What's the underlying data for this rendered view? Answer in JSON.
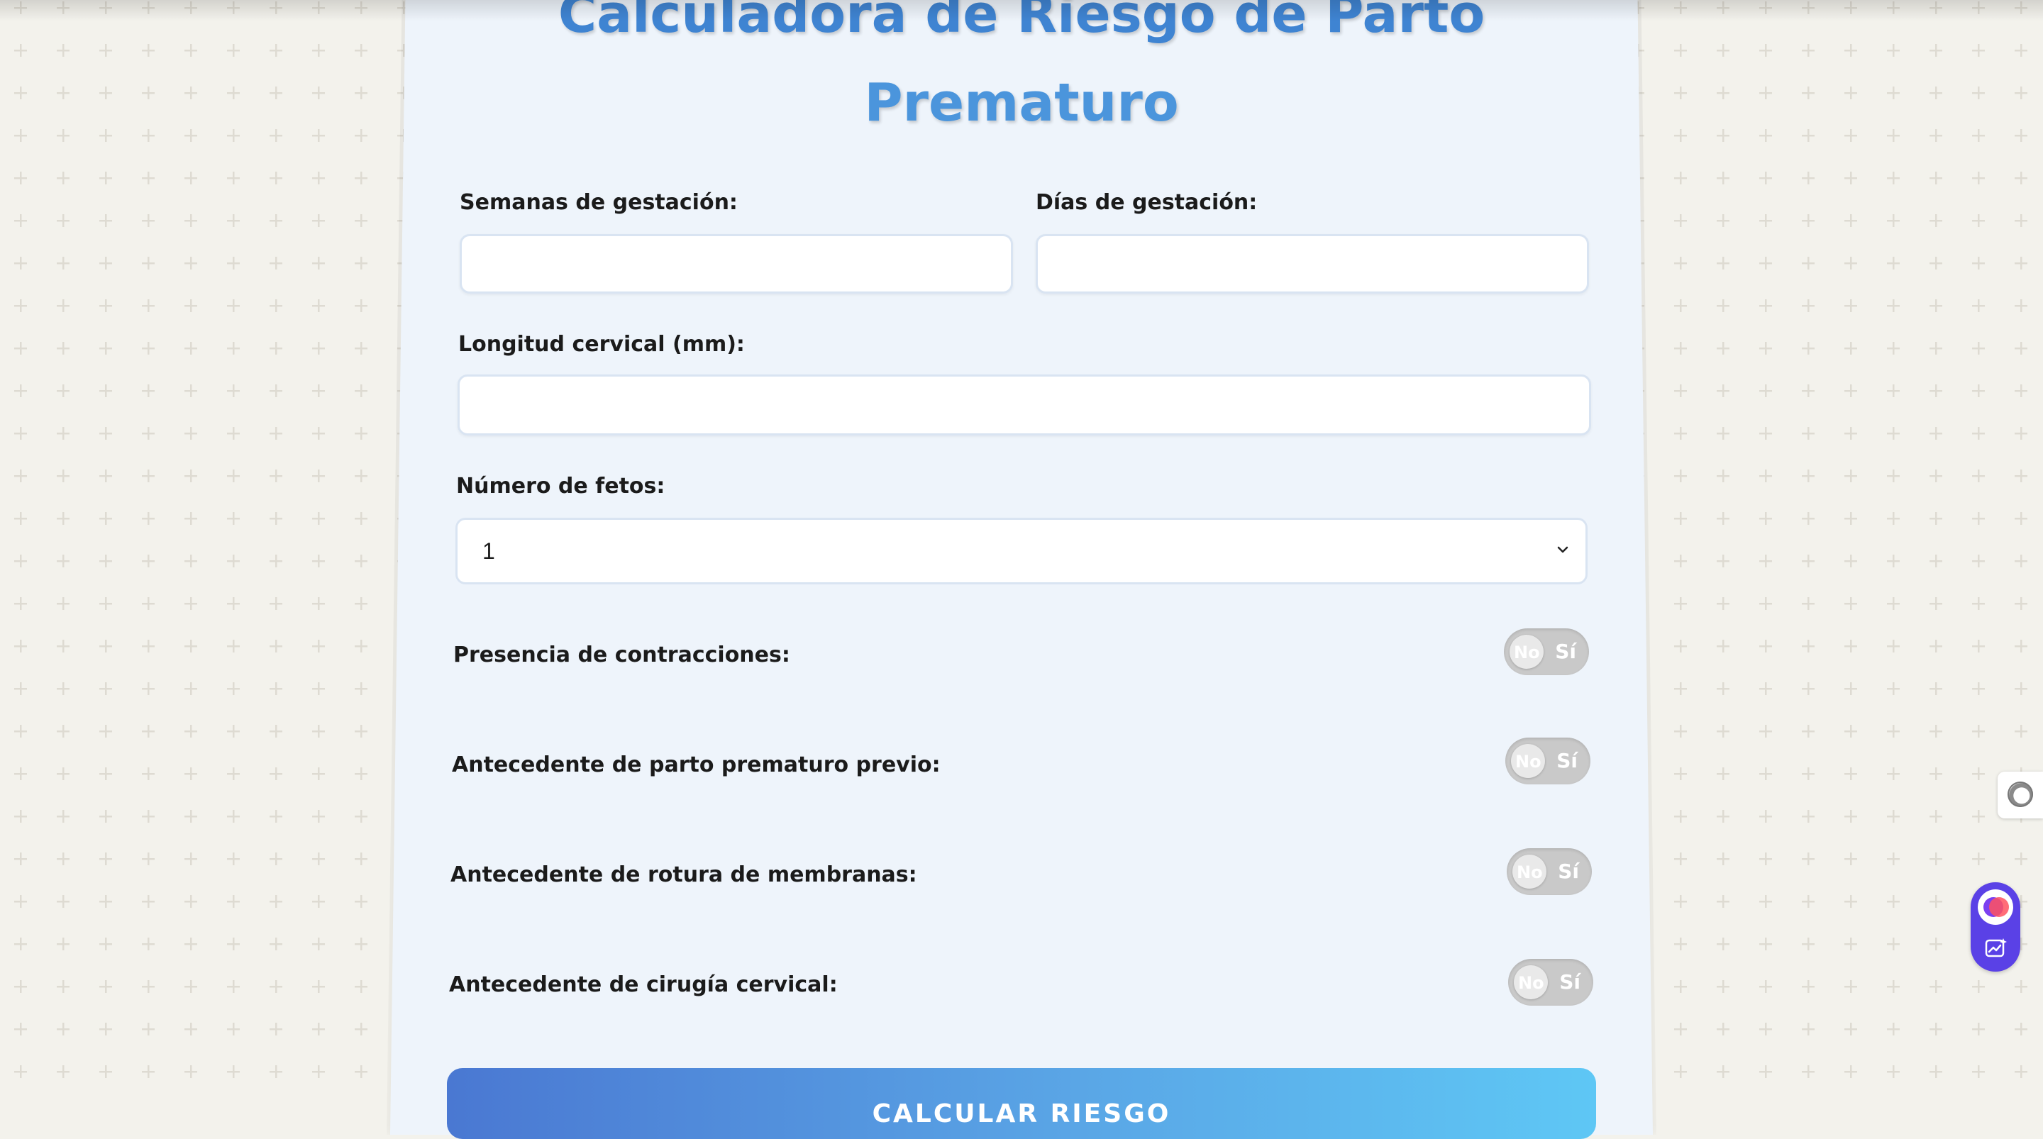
{
  "page": {
    "title_line1": "Calculadora de Riesgo de Parto",
    "title_line2": "Prematuro"
  },
  "form": {
    "weeks": {
      "label": "Semanas de gestación:",
      "value": ""
    },
    "days": {
      "label": "Días de gestación:",
      "value": ""
    },
    "cervical_length": {
      "label": "Longitud cervical (mm):",
      "value": ""
    },
    "fetuses": {
      "label": "Número de fetos:",
      "selected": "1"
    },
    "toggles": [
      {
        "label": "Presencia de contracciones:",
        "off_text": "No",
        "on_text": "Sí"
      },
      {
        "label": "Antecedente de parto prematuro previo:",
        "off_text": "No",
        "on_text": "Sí"
      },
      {
        "label": "Antecedente de rotura de membranas:",
        "off_text": "No",
        "on_text": "Sí"
      },
      {
        "label": "Antecedente de cirugía cervical:",
        "off_text": "No",
        "on_text": "Sí"
      }
    ],
    "submit_label": "CALCULAR RIESGO"
  },
  "colors": {
    "title": "#4a8fd6",
    "card": "#eef4fb",
    "button_start": "#4a78d2",
    "button_end": "#5ec7f5",
    "toggle_off": "#c9c9c9",
    "widget": "#5a41e6"
  },
  "icons": {
    "chevron": "chevron-down-icon",
    "side_tab": "ring-icon",
    "widget_logo": "extension-logo-icon",
    "widget_chart": "chart-sparkle-icon"
  }
}
